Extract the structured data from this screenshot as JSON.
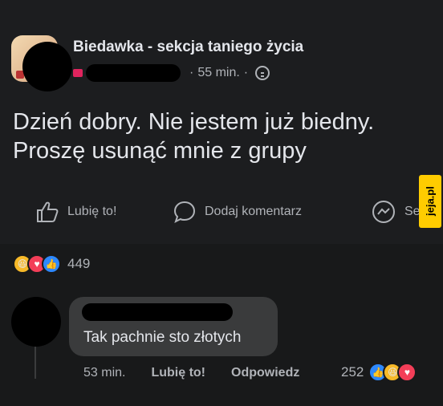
{
  "post": {
    "group_name": "Biedawka - sekcja taniego życia",
    "time": "55 min.",
    "separator": "·",
    "text_line1": "Dzień dobry. Nie jestem już biedny.",
    "text_line2": "Proszę usunąć mnie z grupy",
    "privacy_icon": "globe-icon"
  },
  "actions": {
    "like_label": "Lubię to!",
    "comment_label": "Dodaj komentarz",
    "send_label": "Sen"
  },
  "watermark": "jeja.pl",
  "reactions": {
    "count": "449",
    "icons": [
      "haha-icon",
      "love-icon",
      "like-icon"
    ]
  },
  "comment": {
    "text": "Tak pachnie sto złotych",
    "time": "53 min.",
    "like_label": "Lubię to!",
    "reply_label": "Odpowiedz",
    "reaction_count": "252",
    "reaction_icons": [
      "like-icon",
      "haha-icon",
      "love-icon"
    ]
  },
  "colors": {
    "background": "#18191a",
    "text_primary": "#e4e6eb",
    "text_secondary": "#b0b3b8",
    "bubble": "#3a3b3c",
    "like_blue": "#2d88ff",
    "love_red": "#f33e58",
    "haha_yellow": "#f7b928"
  }
}
